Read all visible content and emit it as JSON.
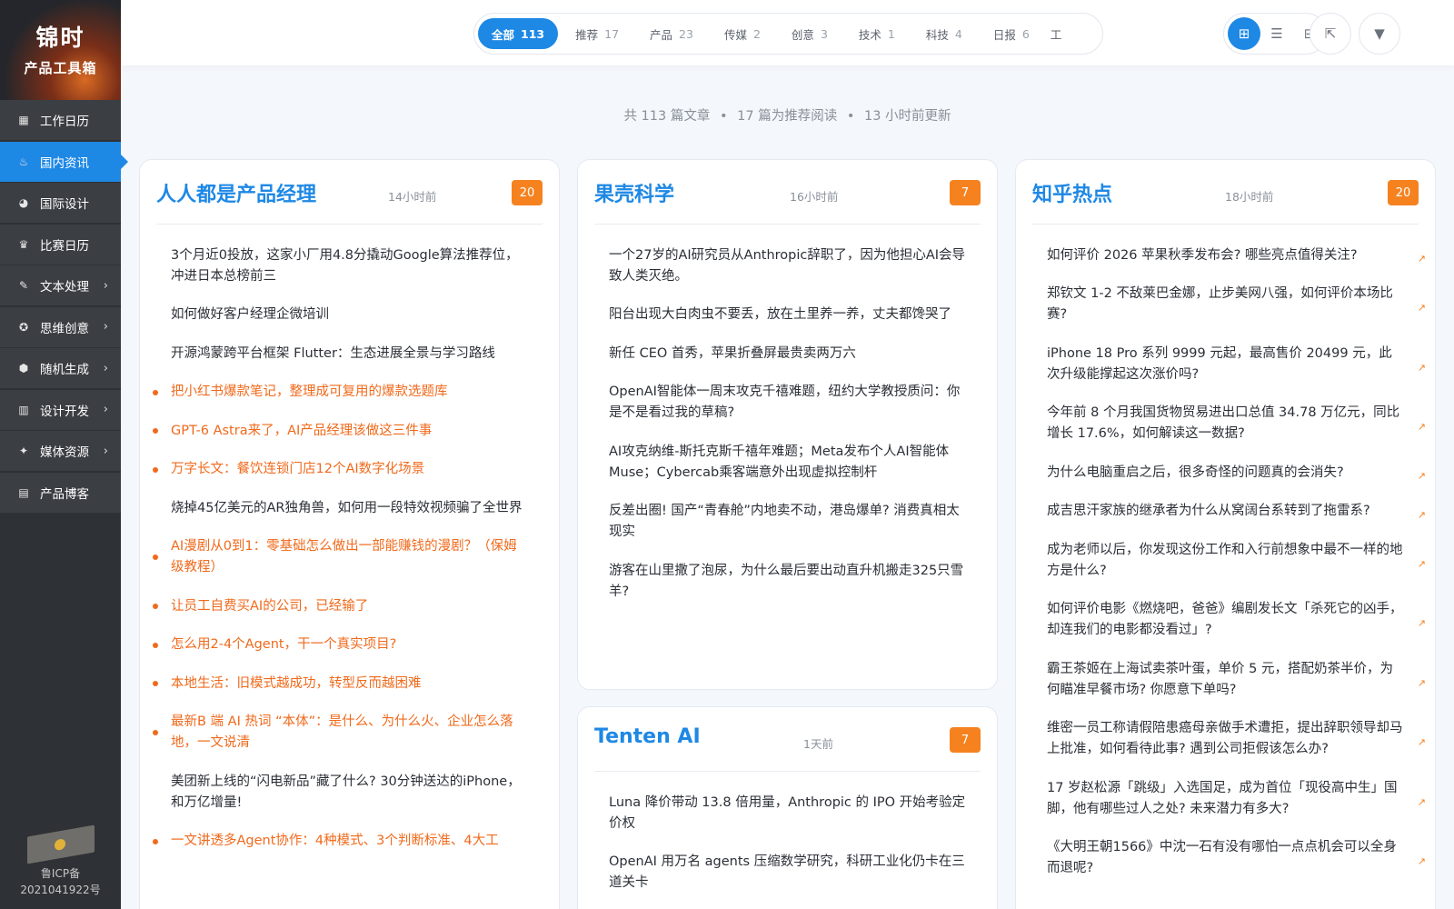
{
  "brand": {
    "line1": "锦时",
    "line2": "产品工具箱"
  },
  "sidebar": {
    "items": [
      {
        "label": "工作日历",
        "icon": "calendar-icon",
        "glyph": "▦",
        "active": false,
        "chevron": false
      },
      {
        "label": "国内资讯",
        "icon": "flame-icon",
        "glyph": "♨",
        "active": true,
        "chevron": false
      },
      {
        "label": "国际设计",
        "icon": "palette-icon",
        "glyph": "◕",
        "active": false,
        "chevron": false
      },
      {
        "label": "比赛日历",
        "icon": "trophy-icon",
        "glyph": "♛",
        "active": false,
        "chevron": false
      },
      {
        "label": "文本处理",
        "icon": "edit-icon",
        "glyph": "✎",
        "active": false,
        "chevron": true
      },
      {
        "label": "思维创意",
        "icon": "lightbulb-icon",
        "glyph": "✪",
        "active": false,
        "chevron": true
      },
      {
        "label": "随机生成",
        "icon": "dice-icon",
        "glyph": "⬢",
        "active": false,
        "chevron": true
      },
      {
        "label": "设计开发",
        "icon": "code-icon",
        "glyph": "▥",
        "active": false,
        "chevron": true
      },
      {
        "label": "媒体资源",
        "icon": "sparkle-icon",
        "glyph": "✦",
        "active": false,
        "chevron": true
      },
      {
        "label": "产品博客",
        "icon": "newspaper-icon",
        "glyph": "▤",
        "active": false,
        "chevron": false
      }
    ],
    "chevron_glyph": "›"
  },
  "footer": {
    "icp_label": "鲁ICP备",
    "icp_number": "2021041922号"
  },
  "tabs": [
    {
      "label": "全部",
      "count": "113",
      "active": true
    },
    {
      "label": "推荐",
      "count": "17",
      "active": false
    },
    {
      "label": "产品",
      "count": "23",
      "active": false
    },
    {
      "label": "传媒",
      "count": "2",
      "active": false
    },
    {
      "label": "创意",
      "count": "3",
      "active": false
    },
    {
      "label": "技术",
      "count": "1",
      "active": false
    },
    {
      "label": "科技",
      "count": "4",
      "active": false
    },
    {
      "label": "日报",
      "count": "6",
      "active": false
    }
  ],
  "tabs_partial": "工",
  "toolbar": {
    "view_buttons": [
      {
        "icon": "grid-view-icon",
        "glyph": "⊞",
        "active": true
      },
      {
        "icon": "list-view-icon",
        "glyph": "☰",
        "active": false
      },
      {
        "icon": "card-view-icon",
        "glyph": "⊟",
        "active": false
      }
    ],
    "share_icon_glyph": "⇱",
    "filter_icon_glyph": "▼"
  },
  "summary": {
    "total": "共 113 篇文章",
    "recommended": "17 篇为推荐阅读",
    "updated": "13 小时前更新",
    "sep": "•"
  },
  "cards": {
    "c1": {
      "title": "人人都是产品经理",
      "time": "14小时前",
      "badge": "20",
      "items": [
        {
          "text": "3个月近0投放，这家小厂用4.8分撬动Google算法推荐位，冲进日本总榜前三",
          "hot": false
        },
        {
          "text": "如何做好客户经理企微培训",
          "hot": false
        },
        {
          "text": "开源鸿蒙跨平台框架 Flutter：生态进展全景与学习路线",
          "hot": false
        },
        {
          "text": "把小红书爆款笔记，整理成可复用的爆款选题库",
          "hot": true
        },
        {
          "text": "GPT-6 Astra来了，AI产品经理该做这三件事",
          "hot": true
        },
        {
          "text": "万字长文：餐饮连锁门店12个AI数字化场景",
          "hot": true
        },
        {
          "text": "烧掉45亿美元的AR独角兽，如何用一段特效视频骗了全世界",
          "hot": false
        },
        {
          "text": "AI漫剧从0到1：零基础怎么做出一部能赚钱的漫剧？（保姆级教程）",
          "hot": true
        },
        {
          "text": "让员工自费买AI的公司，已经输了",
          "hot": true
        },
        {
          "text": "怎么用2-4个Agent，干一个真实项目?",
          "hot": true
        },
        {
          "text": "本地生活：旧模式越成功，转型反而越困难",
          "hot": true
        },
        {
          "text": "最新B 端 AI 热词 “本体”：是什么、为什么火、企业怎么落地，一文说清",
          "hot": true
        },
        {
          "text": "美团新上线的“闪电新品”藏了什么? 30分钟送达的iPhone，和万亿增量!",
          "hot": false
        },
        {
          "text": "一文讲透多Agent协作：4种模式、3个判断标准、4大工",
          "hot": true
        }
      ]
    },
    "c2": {
      "title": "果壳科学",
      "time": "16小时前",
      "badge": "7",
      "items": [
        {
          "text": "一个27岁的AI研究员从Anthropic辞职了，因为他担心AI会导致人类灭绝。",
          "hot": false
        },
        {
          "text": "阳台出现大白肉虫不要丢，放在土里养一养，丈夫都馋哭了",
          "hot": false
        },
        {
          "text": "新任 CEO 首秀，苹果折叠屏最贵卖两万六",
          "hot": false
        },
        {
          "text": "OpenAI智能体一周末攻克千禧难题，纽约大学教授质问：你是不是看过我的草稿?",
          "hot": false
        },
        {
          "text": "AI攻克纳维-斯托克斯千禧年难题；Meta发布个人AI智能体Muse；Cybercab乘客端意外出现虚拟控制杆",
          "hot": false
        },
        {
          "text": "反差出圈! 国产“青春舱”内地卖不动，港岛爆单? 消费真相太现实",
          "hot": false
        },
        {
          "text": "游客在山里撒了泡尿，为什么最后要出动直升机搬走325只雪羊?",
          "hot": false
        }
      ]
    },
    "c3": {
      "title": "Tenten AI",
      "time": "1天前",
      "badge": "7",
      "items": [
        {
          "text": "Luna 降价带动 13.8 倍用量，Anthropic 的 IPO 开始考验定价权",
          "hot": false
        },
        {
          "text": "OpenAI 用万名 agents 压缩数学研究，科研工业化仍卡在三道关卡",
          "hot": false
        }
      ]
    },
    "c4": {
      "title": "知乎热点",
      "time": "18小时前",
      "badge": "20",
      "arrow": "↗",
      "items": [
        {
          "text": "如何评价 2026 苹果秋季发布会? 哪些亮点值得关注?",
          "hot": false
        },
        {
          "text": "郑钦文 1-2 不敌莱巴金娜，止步美网八强，如何评价本场比赛?",
          "hot": false
        },
        {
          "text": "iPhone 18 Pro 系列 9999 元起，最高售价 20499 元，此次升级能撑起这次涨价吗?",
          "hot": false
        },
        {
          "text": "今年前 8 个月我国货物贸易进出口总值 34.78 万亿元，同比增长 17.6%，如何解读这一数据?",
          "hot": false
        },
        {
          "text": "为什么电脑重启之后，很多奇怪的问题真的会消失?",
          "hot": false
        },
        {
          "text": "成吉思汗家族的继承者为什么从窝阔台系转到了拖雷系?",
          "hot": false
        },
        {
          "text": "成为老师以后，你发现这份工作和入行前想象中最不一样的地方是什么?",
          "hot": false
        },
        {
          "text": "如何评价电影《燃烧吧，爸爸》编剧发长文「杀死它的凶手，却连我们的电影都没看过」?",
          "hot": false
        },
        {
          "text": "霸王茶姬在上海试卖茶叶蛋，单价 5 元，搭配奶茶半价，为何瞄准早餐市场? 你愿意下单吗?",
          "hot": false
        },
        {
          "text": "维密一员工称请假陪患癌母亲做手术遭拒，提出辞职领导却马上批准，如何看待此事? 遇到公司拒假该怎么办?",
          "hot": false
        },
        {
          "text": "17 岁赵松源「跳级」入选国足，成为首位「现役高中生」国脚，他有哪些过人之处? 未来潜力有多大?",
          "hot": false
        },
        {
          "text": "《大明王朝1566》中沈一石有没有哪怕一点点机会可以全身而退呢?",
          "hot": false
        }
      ]
    }
  },
  "colors": {
    "accent": "#1e88e5",
    "badge": "#f5821f",
    "hot": "#f06a1c",
    "sidebar": "#2e3135"
  }
}
